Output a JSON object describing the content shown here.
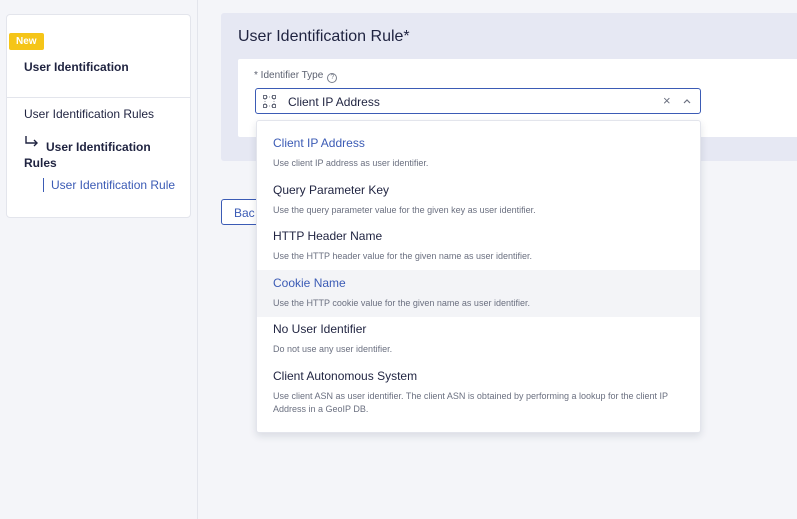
{
  "sidebar": {
    "badge": "New",
    "title": "User Identification",
    "link": "User Identification Rules",
    "current": "User Identification Rules",
    "sub": "User Identification Rule"
  },
  "form": {
    "title": "User Identification Rule*",
    "field_label": "* Identifier Type",
    "help_glyph": "?",
    "selected_value": "Client IP Address",
    "clear_glyph": "×",
    "back_label": "Bac"
  },
  "dropdown": {
    "options": [
      {
        "label": "Client IP Address",
        "description": "Use client IP address as user identifier."
      },
      {
        "label": "Query Parameter Key",
        "description": "Use the query parameter value for the given key as user identifier."
      },
      {
        "label": "HTTP Header Name",
        "description": "Use the HTTP header value for the given name as user identifier."
      },
      {
        "label": "Cookie Name",
        "description": "Use the HTTP cookie value for the given name as user identifier."
      },
      {
        "label": "No User Identifier",
        "description": "Do not use any user identifier."
      },
      {
        "label": "Client Autonomous System",
        "description": "Use client ASN as user identifier. The client ASN is obtained by performing a lookup for the client IP Address in a GeoIP DB."
      }
    ]
  },
  "colors": {
    "accent": "#3b5bb5",
    "badge": "#f5c518",
    "panel": "#e6e8f3",
    "background": "#f4f5f9"
  }
}
